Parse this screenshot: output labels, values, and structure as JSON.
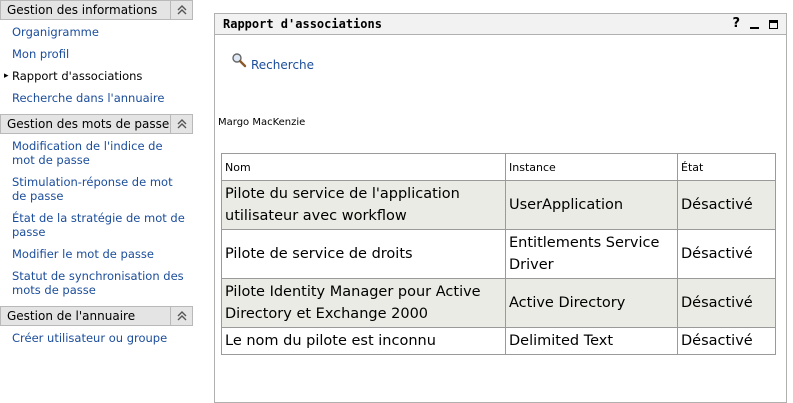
{
  "sidebar": {
    "sections": [
      {
        "title": "Gestion des informations",
        "items": [
          {
            "label": "Organigramme",
            "selected": false
          },
          {
            "label": "Mon profil",
            "selected": false
          },
          {
            "label": "Rapport d'associations",
            "selected": true
          },
          {
            "label": "Recherche dans l'annuaire",
            "selected": false
          }
        ]
      },
      {
        "title": "Gestion des mots de passe",
        "items": [
          {
            "label": "Modification de l'indice de mot de passe",
            "selected": false
          },
          {
            "label": "Stimulation-réponse de mot de passe",
            "selected": false
          },
          {
            "label": "État de la stratégie de mot de passe",
            "selected": false
          },
          {
            "label": "Modifier le mot de passe",
            "selected": false
          },
          {
            "label": "Statut de synchronisation des mots de passe",
            "selected": false
          }
        ]
      },
      {
        "title": "Gestion de l'annuaire",
        "items": [
          {
            "label": "Créer utilisateur ou groupe",
            "selected": false
          }
        ]
      }
    ],
    "collapse_icon": "double-chevron-up-icon",
    "bullet": "▸"
  },
  "portlet": {
    "title": "Rapport d'associations",
    "help_label": "?",
    "search_label": "Recherche",
    "user_name": "Margo MacKenzie",
    "table": {
      "headers": {
        "name": "Nom",
        "instance": "Instance",
        "state": "État"
      },
      "rows": [
        {
          "name": "Pilote du service de l'application utilisateur avec workflow",
          "instance": "UserApplication",
          "state": "Désactivé"
        },
        {
          "name": "Pilote de service de droits",
          "instance": "Entitlements Service Driver",
          "state": "Désactivé"
        },
        {
          "name": "Pilote Identity Manager pour Active Directory et Exchange 2000",
          "instance": "Active Directory",
          "state": "Désactivé"
        },
        {
          "name": "Le nom du pilote est inconnu",
          "instance": "Delimited Text",
          "state": "Désactivé"
        }
      ]
    }
  },
  "colors": {
    "link": "#1b4d9b",
    "header_bg": "#e4e4e4",
    "row_shade": "#ebebe5"
  }
}
